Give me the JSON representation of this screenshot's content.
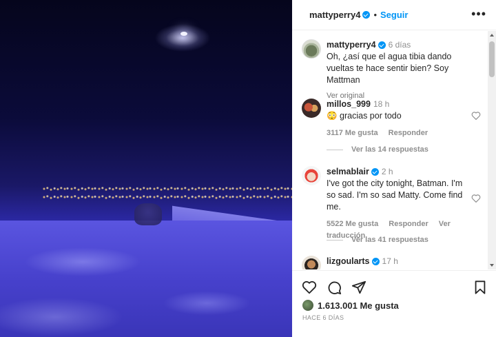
{
  "post": {
    "username": "mattyperry4",
    "follow_label": "Seguir",
    "separator": "•",
    "more_label": "•••"
  },
  "caption": {
    "username": "mattyperry4",
    "time": "6 días",
    "text": "Oh, ¿así que el agua tibia dando vueltas te hace sentir bien? Soy Mattman",
    "translate_label": "Ver original"
  },
  "comments": [
    {
      "username": "millos_999",
      "verified": false,
      "time": "18 h",
      "text": "😳 gracias por todo",
      "likes": "3117 Me gusta",
      "reply_label": "Responder",
      "replies_label": "Ver las 14 respuestas"
    },
    {
      "username": "selmablair",
      "verified": true,
      "time": "2 h",
      "text": "I've got the city tonight, Batman. I'm so sad. I'm so sad Matty. Come find me.",
      "likes": "5522 Me gusta",
      "reply_label": "Responder",
      "translate_label": "Ver traducción",
      "replies_label": "Ver las 41 respuestas"
    },
    {
      "username": "lizgoularts",
      "verified": true,
      "time": "17 h"
    }
  ],
  "footer": {
    "likes": "1.613.001 Me gusta",
    "posted": "Hace 6 días"
  },
  "icons": [
    "heart-icon",
    "comment-icon",
    "share-icon",
    "bookmark-icon",
    "verified-icon",
    "more-icon"
  ],
  "colors": {
    "accent": "#0095f6",
    "text": "#262626",
    "muted": "#8e8e8e"
  }
}
